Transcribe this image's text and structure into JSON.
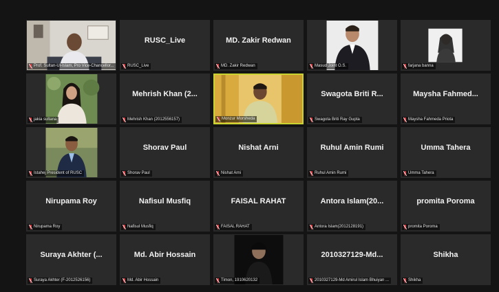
{
  "meeting": {
    "tiles": [
      {
        "title": "",
        "nametag": "Prof. Sultan-Ul-Islam, Pro Vice-Chancellor...",
        "video": "pvc"
      },
      {
        "title": "RUSC_Live",
        "nametag": "RUSC_Live"
      },
      {
        "title": "MD. Zakir Redwan",
        "nametag": "MD. Zakir Redwan"
      },
      {
        "title": "",
        "nametag": "Masud Joint O.S.",
        "video": "masud"
      },
      {
        "title": "",
        "nametag": "farjana banna",
        "video": "farjana"
      },
      {
        "title": "",
        "nametag": "jakia sultana",
        "video": "jakia"
      },
      {
        "title": "Mehrish Khan (2...",
        "nametag": "Mehrish Khan (2012556157)"
      },
      {
        "title": "",
        "nametag": "Monzur Morsheda",
        "video": "monzur",
        "active": true
      },
      {
        "title": "Swagota Briti R...",
        "nametag": "Swagota Briti Ray Gupta"
      },
      {
        "title": "Maysha Fahmed...",
        "nametag": "Maysha Fahmeda Priota"
      },
      {
        "title": "",
        "nametag": "Istahej President of RUSC",
        "video": "istahej"
      },
      {
        "title": "Shorav Paul",
        "nametag": "Shorav Paul"
      },
      {
        "title": "Nishat Arni",
        "nametag": "Nishat Arni"
      },
      {
        "title": "Ruhul Amin Rumi",
        "nametag": "Ruhul Amin Rumi"
      },
      {
        "title": "Umma Tahera",
        "nametag": "Umma Tahera"
      },
      {
        "title": "Nirupama Roy",
        "nametag": "Nirupama Roy"
      },
      {
        "title": "Nafisul Musfiq",
        "nametag": "Nafisul Musfiq"
      },
      {
        "title": "FAISAL RAHAT",
        "nametag": "FAISAL RAHAT"
      },
      {
        "title": "Antora Islam(20...",
        "nametag": "Antora Islam(2012128191)"
      },
      {
        "title": "promita Poroma",
        "nametag": "promita Poroma"
      },
      {
        "title": "Suraya Akhter (...",
        "nametag": "Suraya Akhter (F-2012526156)"
      },
      {
        "title": "Md. Abir Hossain",
        "nametag": "Md. Abir Hossain"
      },
      {
        "title": "",
        "nametag": "Timon, 1910620132",
        "video": "timon"
      },
      {
        "title": "2010327129-Md...",
        "nametag": "2010327129-Md Amirul Islam Bhuiyan ..."
      },
      {
        "title": "Shikha",
        "nametag": "Shikha"
      }
    ],
    "colors": {
      "background": "#141414",
      "tile": "#2a2a2a",
      "active_speaker_border": "#c9d431",
      "muted_mic": "#e0383e"
    }
  }
}
